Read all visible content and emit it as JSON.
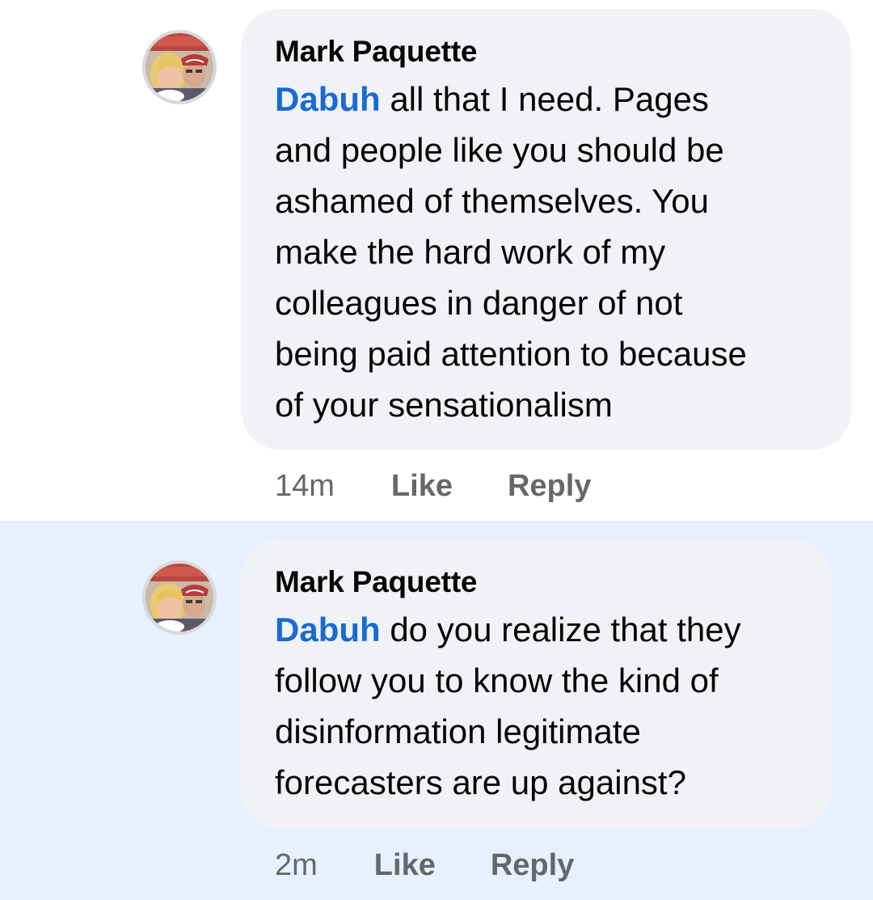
{
  "comments": [
    {
      "author": "Mark Paquette",
      "mention": "Dabuh",
      "lines": [
        " all that I need. Pages",
        "and people like you should be",
        "ashamed of themselves. You",
        "make the hard work of my",
        "colleagues in danger of not",
        "being paid attention to because",
        "of your sensationalism"
      ],
      "time": "14m",
      "like_label": "Like",
      "reply_label": "Reply",
      "highlighted": false
    },
    {
      "author": "Mark Paquette",
      "mention": "Dabuh",
      "lines": [
        " do you realize that they",
        "follow you to know the kind of",
        "disinformation legitimate",
        "forecasters are up against?"
      ],
      "time": "2m",
      "like_label": "Like",
      "reply_label": "Reply",
      "highlighted": true
    }
  ],
  "colors": {
    "bubble": "#f0f2f5",
    "highlight": "#e7f0fc",
    "mention": "#1a6ad2",
    "meta": "#65676b"
  }
}
